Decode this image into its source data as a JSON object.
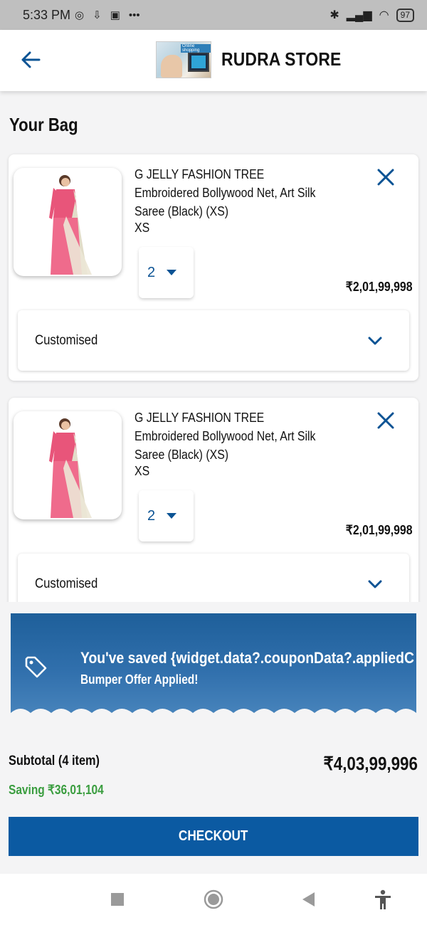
{
  "status_bar": {
    "time": "5:33 PM",
    "battery": "97"
  },
  "app_bar": {
    "title": "RUDRA STORE",
    "logo_text": "Online shopping"
  },
  "page": {
    "title": "Your Bag"
  },
  "cart": {
    "items": [
      {
        "title": "G JELLY FASHION TREE  Embroidered Bollywood Net, Art Silk Saree  (Black)  (XS)",
        "size": "XS",
        "quantity": "2",
        "price": "₹2,01,99,998",
        "customised_label": "Customised"
      },
      {
        "title": "G JELLY FASHION TREE  Embroidered Bollywood Net, Art Silk Saree  (Black)  (XS)",
        "size": "XS",
        "quantity": "2",
        "price": "₹2,01,99,998",
        "customised_label": "Customised"
      }
    ]
  },
  "coupon": {
    "title": "You've saved {widget.data?.couponData?.appliedC",
    "subtitle": "Bumper Offer Applied!"
  },
  "summary": {
    "subtotal_label": "Subtotal  (4 item)",
    "subtotal_value": "₹4,03,99,996",
    "saving": "Saving ₹36,01,104",
    "checkout_label": "CHECKOUT"
  },
  "colors": {
    "primary": "#0b5aa2",
    "accent_icon": "#0b5394",
    "saving": "#3a9d3f",
    "banner": "#2f6faa"
  },
  "icons": [
    "back-arrow-icon",
    "close-icon",
    "chevron-down-icon",
    "dropdown-arrow-icon",
    "tag-icon",
    "recents-icon",
    "home-icon",
    "back-icon",
    "accessibility-icon"
  ]
}
